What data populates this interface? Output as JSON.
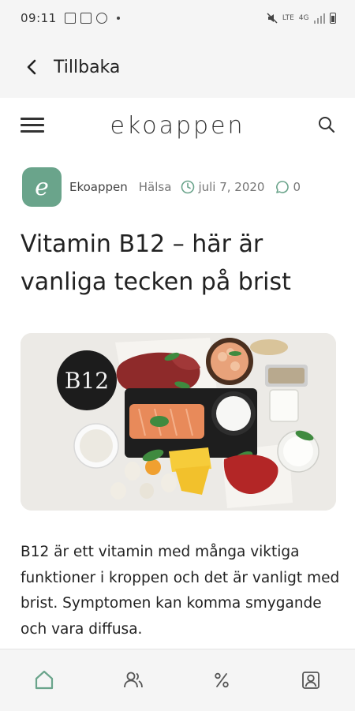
{
  "status_bar": {
    "time": "09:11",
    "network_lte_label": "LTE",
    "network_4g_label": "4G"
  },
  "header": {
    "back_label": "Tillbaka",
    "site_logo": "ekoappen"
  },
  "article": {
    "avatar_letter": "e",
    "author": "Ekoappen",
    "category": "Hälsa",
    "date": "juli 7, 2020",
    "comment_count": "0",
    "title": "Vitamin B12 – här är vanliga tecken på brist",
    "image_badge_text": "B12",
    "body": "B12 är ett vitamin med många viktiga funktioner i kroppen och det är vanligt med brist. Symptomen kan komma smygande och vara diffusa."
  },
  "bottom_nav": {
    "items": [
      {
        "icon": "home-icon",
        "active": true
      },
      {
        "icon": "people-icon",
        "active": false
      },
      {
        "icon": "percent-icon",
        "active": false
      },
      {
        "icon": "profile-icon",
        "active": false
      }
    ]
  },
  "colors": {
    "accent": "#6aa48b",
    "chrome_background": "#f5f5f5",
    "text": "#222222"
  }
}
